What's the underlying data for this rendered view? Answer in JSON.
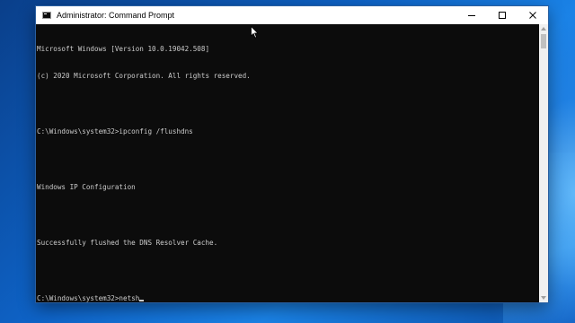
{
  "window": {
    "title": "Administrator: Command Prompt",
    "icon": "cmd-icon"
  },
  "controls": {
    "minimize_icon": "minimize-icon",
    "maximize_icon": "maximize-icon",
    "close_icon": "close-icon"
  },
  "console": {
    "lines": [
      "Microsoft Windows [Version 10.0.19042.508]",
      "(c) 2020 Microsoft Corporation. All rights reserved.",
      "",
      "C:\\Windows\\system32>ipconfig /flushdns",
      "",
      "Windows IP Configuration",
      "",
      "Successfully flushed the DNS Resolver Cache.",
      "",
      "C:\\Windows\\system32>netsh"
    ]
  },
  "colors": {
    "console_bg": "#0c0c0c",
    "console_text": "#cccccc",
    "titlebar_bg": "#ffffff",
    "desktop_accent": "#0e63c7"
  }
}
